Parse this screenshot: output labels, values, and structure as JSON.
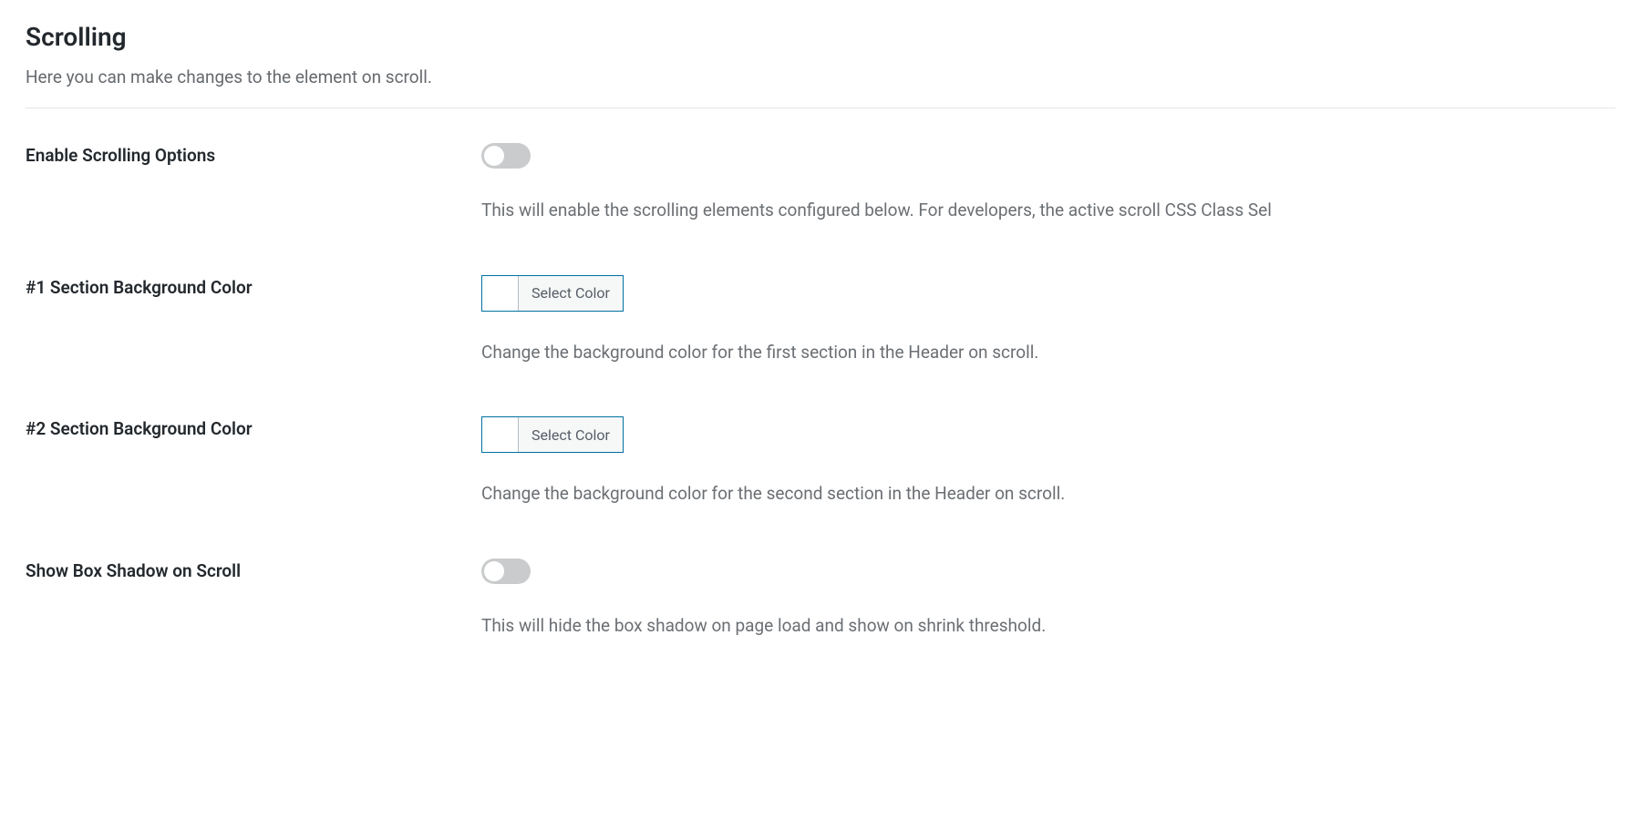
{
  "section": {
    "title": "Scrolling",
    "description": "Here you can make changes to the element on scroll."
  },
  "options": {
    "enableScrolling": {
      "label": "Enable Scrolling Options",
      "help": "This will enable the scrolling elements configured below. For developers, the active scroll CSS Class Sel"
    },
    "section1Bg": {
      "label": "#1 Section Background Color",
      "button": "Select Color",
      "help": "Change the background color for the first section in the Header on scroll."
    },
    "section2Bg": {
      "label": "#2 Section Background Color",
      "button": "Select Color",
      "help": "Change the background color for the second section in the Header on scroll."
    },
    "boxShadow": {
      "label": "Show Box Shadow on Scroll",
      "help": "This will hide the box shadow on page load and show on shrink threshold."
    }
  }
}
